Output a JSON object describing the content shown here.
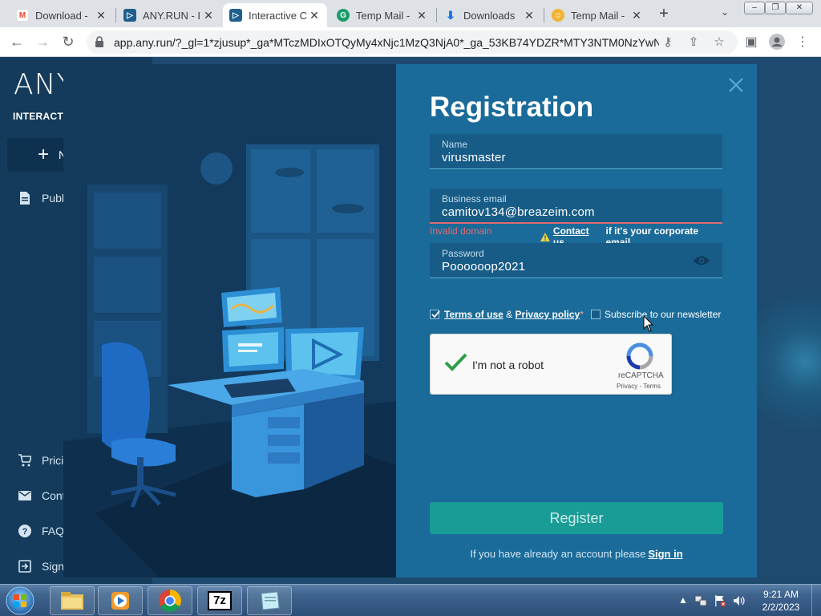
{
  "browser": {
    "tabs": [
      {
        "title": "Download - ",
        "favicon": "gmail-icon",
        "color": "#ea4335"
      },
      {
        "title": "ANY.RUN - I",
        "favicon": "anyrun-icon",
        "color": "#1e5f8c"
      },
      {
        "title": "Interactive C",
        "favicon": "anyrun-icon",
        "color": "#1e5f8c",
        "active": true
      },
      {
        "title": "Temp Mail - ",
        "favicon": "tempmail-icon",
        "color": "#1a9c6a"
      },
      {
        "title": "Downloads",
        "favicon": "download-icon",
        "color": "#1a73e8"
      },
      {
        "title": "Temp Mail - ",
        "favicon": "tempmail-icon",
        "color": "#f2b233"
      }
    ],
    "url": "app.any.run/?_gl=1*zjusup*_ga*MTczMDIxOTQyMy4xNjc1MzQ3NjA0*_ga_53KB74YDZR*MTY3NTM0NzYwN...",
    "new_tab": "+"
  },
  "sidebar": {
    "logo": "ANY",
    "logo_sub": "INTERACTIVE I",
    "new_task_label": "N",
    "items": [
      {
        "label": "Publ",
        "icon": "document-icon"
      },
      {
        "label": "Prici",
        "icon": "cart-icon"
      },
      {
        "label": "Cont",
        "icon": "mail-icon"
      },
      {
        "label": "FAQ",
        "icon": "help-icon"
      },
      {
        "label": "Sign",
        "icon": "signin-icon"
      }
    ]
  },
  "registration": {
    "title": "Registration",
    "name_label": "Name",
    "name_value": "virusmaster",
    "email_label": "Business email",
    "email_value": "camitov134@breazeim.com",
    "email_error": "Invalid domain",
    "contact_link": "Contact us",
    "contact_suffix": "if it's your corporate email",
    "password_label": "Password",
    "password_value": "Poooooop2021",
    "terms_link": "Terms of use",
    "amp": "&",
    "privacy_link": "Privacy policy",
    "required_mark": "*",
    "newsletter_label": "Subscribe to our newsletter",
    "captcha_label": "I'm not a robot",
    "captcha_brand": "reCAPTCHA",
    "captcha_links": "Privacy - Terms",
    "register_button": "Register",
    "signin_prompt": "If you have already an account please",
    "signin_link": "Sign in"
  },
  "taskbar": {
    "time": "9:21 AM",
    "date": "2/2/2023",
    "apps": [
      "explorer-icon",
      "media-player-icon",
      "chrome-icon",
      "7zip-icon",
      "notepad-icon"
    ],
    "sevenzip_label": "7z"
  },
  "colors": {
    "form_bg": "#1a6b99",
    "register_bg": "#1a9c96",
    "error": "#e06a73",
    "illustration_bg": "#133a5c"
  }
}
